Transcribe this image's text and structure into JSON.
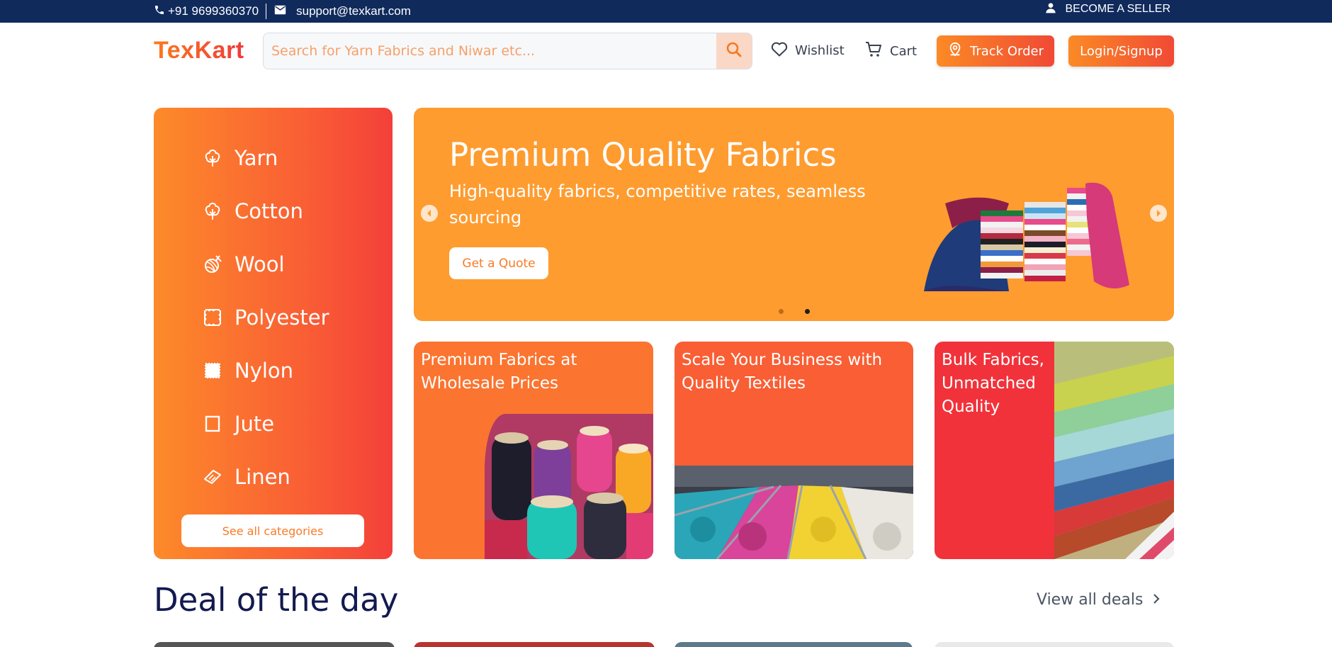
{
  "topbar": {
    "phone": "+91 9699360370",
    "email": "support@texkart.com",
    "seller_label": "BECOME A SELLER"
  },
  "header": {
    "logo": "TexKart",
    "search_placeholder": "Search for Yarn Fabrics and Niwar etc...",
    "wishlist_label": "Wishlist",
    "cart_label": "Cart",
    "track_order_label": "Track Order",
    "login_label": "Login/Signup"
  },
  "categories": {
    "items": [
      {
        "label": "Yarn",
        "icon": "cotton-flower-icon"
      },
      {
        "label": "Cotton",
        "icon": "cotton-flower-icon"
      },
      {
        "label": "Wool",
        "icon": "yarn-ball-icon"
      },
      {
        "label": "Polyester",
        "icon": "fabric-swatch-icon"
      },
      {
        "label": "Nylon",
        "icon": "fabric-square-icon"
      },
      {
        "label": "Jute",
        "icon": "fabric-frame-icon"
      },
      {
        "label": "Linen",
        "icon": "fabric-roll-icon"
      }
    ],
    "see_all_label": "See all categories"
  },
  "hero": {
    "title": "Premium Quality Fabrics",
    "subtitle": "High-quality fabrics, competitive rates, seamless sourcing",
    "cta_label": "Get a Quote",
    "active_slide": 2,
    "slide_count": 2,
    "background_color": "#fe9c30"
  },
  "promos": [
    {
      "title": "Premium Fabrics at Wholesale Prices",
      "color": "#fb7430"
    },
    {
      "title": "Scale Your Business with Quality Textiles",
      "color": "#f95e34"
    },
    {
      "title": "Bulk Fabrics, Unmatched Quality",
      "color": "#f1323a"
    }
  ],
  "deals": {
    "title": "Deal of the day",
    "view_all_label": "View all deals"
  },
  "colors": {
    "topbar": "#102a5c",
    "accent_orange": "#fb8a25",
    "accent_red": "#f04a35",
    "heading_navy": "#131a4f"
  }
}
